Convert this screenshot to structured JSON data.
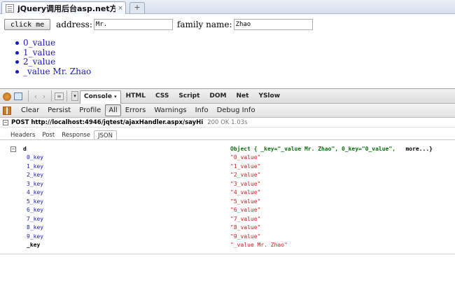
{
  "browser": {
    "tab_title": "jQuery调用后台asp.net方法",
    "tab_close": "×",
    "new_tab": "+"
  },
  "page": {
    "button_label": "click me",
    "address_label": "address:",
    "address_value": "Mr.",
    "family_label": "family name:",
    "family_value": "Zhao",
    "list_items": [
      "0_value",
      "1_value",
      "2_value",
      "_value Mr. Zhao"
    ]
  },
  "firebug": {
    "tabs": [
      "Console",
      "HTML",
      "CSS",
      "Script",
      "DOM",
      "Net",
      "YSlow"
    ],
    "console_chevron": "▾",
    "subtoolbar": [
      "Clear",
      "Persist",
      "Profile",
      "All",
      "Errors",
      "Warnings",
      "Info",
      "Debug Info"
    ],
    "active_filter": "All",
    "request": {
      "line": "POST http://localhost:4946/jqtest/ajaxHandler.aspx/sayHi",
      "status": "200 OK 1.03s"
    },
    "response_tabs": [
      "Headers",
      "Post",
      "Response",
      "JSON"
    ],
    "active_response_tab": "JSON"
  },
  "json_tree": {
    "toggle": "−",
    "root_key": "d",
    "summary": "Object { _key=\"_value Mr. Zhao\",  0_key=\"0_value\",",
    "summary_more": "more...}",
    "rows": [
      {
        "key": "0_key",
        "value": "\"0_value\""
      },
      {
        "key": "1_key",
        "value": "\"1_value\""
      },
      {
        "key": "2_key",
        "value": "\"2_value\""
      },
      {
        "key": "3_key",
        "value": "\"3_value\""
      },
      {
        "key": "4_key",
        "value": "\"4_value\""
      },
      {
        "key": "5_key",
        "value": "\"5_value\""
      },
      {
        "key": "6_key",
        "value": "\"6_value\""
      },
      {
        "key": "7_key",
        "value": "\"7_value\""
      },
      {
        "key": "8_key",
        "value": "\"8_value\""
      },
      {
        "key": "9_key",
        "value": "\"9_value\""
      },
      {
        "key": "_key",
        "value": "\"_value Mr. Zhao\""
      }
    ]
  },
  "colors": {
    "key_blue": "#1a1ab8",
    "value_red": "#cc1e1e",
    "summary_green": "#0b6e0b"
  }
}
